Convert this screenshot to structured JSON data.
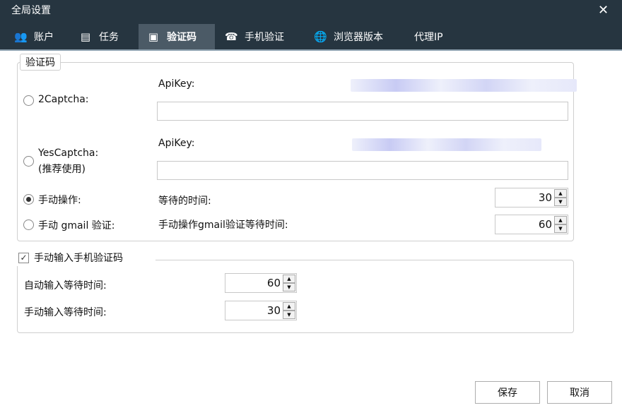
{
  "window": {
    "title": "全局设置",
    "close_glyph": "✕"
  },
  "tabs": [
    {
      "label": "账户",
      "icon": "users-icon"
    },
    {
      "label": "任务",
      "icon": "list-icon"
    },
    {
      "label": "验证码",
      "icon": "id-card-icon"
    },
    {
      "label": "手机验证",
      "icon": "phone-icon"
    },
    {
      "label": "浏览器版本",
      "icon": "globe-icon"
    },
    {
      "label": "代理IP",
      "icon": ""
    }
  ],
  "captcha": {
    "legend": "验证码",
    "twocaptcha": {
      "label": "2Captcha:",
      "apikey_label": "ApiKey:",
      "value": ""
    },
    "yescaptcha": {
      "label": "YesCaptcha:",
      "note": "(推荐使用)",
      "apikey_label": "ApiKey:",
      "value": ""
    },
    "manual": {
      "label": "手动操作:",
      "wait_label": "等待的时间:",
      "wait_value": "30",
      "checked": true
    },
    "gmail": {
      "label": "手动 gmail 验证:",
      "wait_label": "手动操作gmail验证等待时间:",
      "wait_value": "60"
    }
  },
  "phone": {
    "check_label": "手动输入手机验证码",
    "checked": true,
    "auto_label": "自动输入等待时间:",
    "auto_value": "60",
    "manual_label": "手动输入等待时间:",
    "manual_value": "30"
  },
  "buttons": {
    "save": "保存",
    "cancel": "取消"
  }
}
